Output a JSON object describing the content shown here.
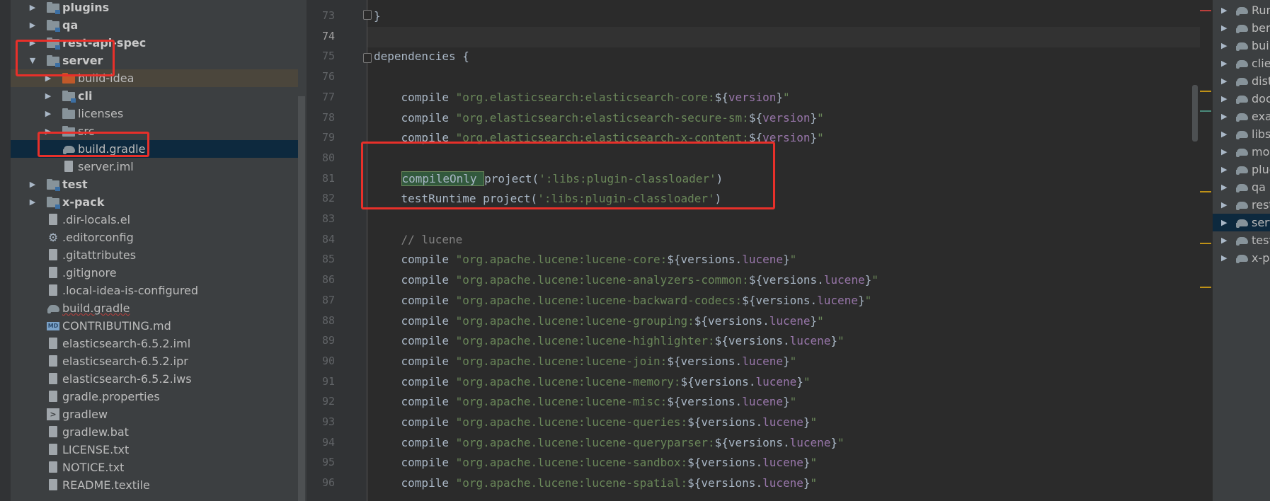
{
  "tree": {
    "items": [
      {
        "label": "plugins",
        "type": "folder-module",
        "expand": "collapsed",
        "level": 0,
        "bold": true
      },
      {
        "label": "qa",
        "type": "folder-module",
        "expand": "collapsed",
        "level": 0,
        "bold": true
      },
      {
        "label": "rest-api-spec",
        "type": "folder-module",
        "expand": "collapsed",
        "level": 0,
        "bold": true
      },
      {
        "label": "server",
        "type": "folder-module",
        "expand": "expanded",
        "level": 0,
        "bold": true
      },
      {
        "label": "build-idea",
        "type": "folder-orange",
        "expand": "collapsed",
        "level": 1,
        "bold": false
      },
      {
        "label": "cli",
        "type": "folder-module",
        "expand": "collapsed",
        "level": 1,
        "bold": true
      },
      {
        "label": "licenses",
        "type": "folder",
        "expand": "collapsed",
        "level": 1,
        "bold": false
      },
      {
        "label": "src",
        "type": "folder",
        "expand": "collapsed",
        "level": 1,
        "bold": false
      },
      {
        "label": "build.gradle",
        "type": "gradle",
        "expand": "none",
        "level": 1,
        "bold": false,
        "selected": true
      },
      {
        "label": "server.iml",
        "type": "file",
        "expand": "none",
        "level": 1,
        "bold": false
      },
      {
        "label": "test",
        "type": "folder-module",
        "expand": "collapsed",
        "level": 0,
        "bold": true
      },
      {
        "label": "x-pack",
        "type": "folder-module",
        "expand": "collapsed",
        "level": 0,
        "bold": true
      },
      {
        "label": ".dir-locals.el",
        "type": "file",
        "expand": "none",
        "level": 0,
        "bold": false
      },
      {
        "label": ".editorconfig",
        "type": "gear",
        "expand": "none",
        "level": 0,
        "bold": false
      },
      {
        "label": ".gitattributes",
        "type": "file",
        "expand": "none",
        "level": 0,
        "bold": false
      },
      {
        "label": ".gitignore",
        "type": "file",
        "expand": "none",
        "level": 0,
        "bold": false
      },
      {
        "label": ".local-idea-is-configured",
        "type": "file",
        "expand": "none",
        "level": 0,
        "bold": false
      },
      {
        "label": "build.gradle",
        "type": "gradle",
        "expand": "none",
        "level": 0,
        "bold": false,
        "squiggle": true
      },
      {
        "label": "CONTRIBUTING.md",
        "type": "md",
        "expand": "none",
        "level": 0,
        "bold": false
      },
      {
        "label": "elasticsearch-6.5.2.iml",
        "type": "file",
        "expand": "none",
        "level": 0,
        "bold": false
      },
      {
        "label": "elasticsearch-6.5.2.ipr",
        "type": "file",
        "expand": "none",
        "level": 0,
        "bold": false
      },
      {
        "label": "elasticsearch-6.5.2.iws",
        "type": "file",
        "expand": "none",
        "level": 0,
        "bold": false
      },
      {
        "label": "gradle.properties",
        "type": "file",
        "expand": "none",
        "level": 0,
        "bold": false
      },
      {
        "label": "gradlew",
        "type": "terminal",
        "expand": "none",
        "level": 0,
        "bold": false
      },
      {
        "label": "gradlew.bat",
        "type": "file",
        "expand": "none",
        "level": 0,
        "bold": false
      },
      {
        "label": "LICENSE.txt",
        "type": "file",
        "expand": "none",
        "level": 0,
        "bold": false
      },
      {
        "label": "NOTICE.txt",
        "type": "file",
        "expand": "none",
        "level": 0,
        "bold": false
      },
      {
        "label": "README.textile",
        "type": "file",
        "expand": "none",
        "level": 0,
        "bold": false
      }
    ]
  },
  "editor": {
    "current_line": "74",
    "lines": [
      {
        "num": "73",
        "tokens": [
          {
            "t": "}",
            "c": "kw"
          }
        ]
      },
      {
        "num": "74",
        "tokens": []
      },
      {
        "num": "75",
        "tokens": [
          {
            "t": "dependencies {",
            "c": "kw"
          }
        ]
      },
      {
        "num": "76",
        "tokens": []
      },
      {
        "num": "77",
        "tokens": [
          {
            "t": "    compile ",
            "c": "kw"
          },
          {
            "t": "\"org.elasticsearch:elasticsearch-core:",
            "c": "str"
          },
          {
            "t": "${",
            "c": "kw"
          },
          {
            "t": "version",
            "c": "var"
          },
          {
            "t": "}",
            "c": "kw"
          },
          {
            "t": "\"",
            "c": "str"
          }
        ]
      },
      {
        "num": "78",
        "tokens": [
          {
            "t": "    compile ",
            "c": "kw"
          },
          {
            "t": "\"org.elasticsearch:elasticsearch-secure-sm:",
            "c": "str"
          },
          {
            "t": "${",
            "c": "kw"
          },
          {
            "t": "version",
            "c": "var"
          },
          {
            "t": "}",
            "c": "kw"
          },
          {
            "t": "\"",
            "c": "str"
          }
        ]
      },
      {
        "num": "79",
        "tokens": [
          {
            "t": "    compile ",
            "c": "kw"
          },
          {
            "t": "\"org.elasticsearch:elasticsearch-x-content:",
            "c": "str"
          },
          {
            "t": "${",
            "c": "kw"
          },
          {
            "t": "version",
            "c": "var"
          },
          {
            "t": "}",
            "c": "kw"
          },
          {
            "t": "\"",
            "c": "str"
          }
        ]
      },
      {
        "num": "80",
        "tokens": []
      },
      {
        "num": "81",
        "tokens": [
          {
            "t": "    ",
            "c": "kw"
          },
          {
            "t": "compileOnly ",
            "c": "mark"
          },
          {
            "t": "project(",
            "c": "kw"
          },
          {
            "t": "':libs:plugin-classloader'",
            "c": "str"
          },
          {
            "t": ")",
            "c": "kw"
          }
        ]
      },
      {
        "num": "82",
        "tokens": [
          {
            "t": "    testRuntime project(",
            "c": "kw"
          },
          {
            "t": "':libs:plugin-classloader'",
            "c": "str"
          },
          {
            "t": ")",
            "c": "kw"
          }
        ]
      },
      {
        "num": "83",
        "tokens": []
      },
      {
        "num": "84",
        "tokens": [
          {
            "t": "    // lucene",
            "c": "cmt"
          }
        ]
      },
      {
        "num": "85",
        "tokens": [
          {
            "t": "    compile ",
            "c": "kw"
          },
          {
            "t": "\"org.apache.lucene:lucene-core:",
            "c": "str"
          },
          {
            "t": "${versions.",
            "c": "kw"
          },
          {
            "t": "lucene",
            "c": "var"
          },
          {
            "t": "}",
            "c": "kw"
          },
          {
            "t": "\"",
            "c": "str"
          }
        ]
      },
      {
        "num": "86",
        "tokens": [
          {
            "t": "    compile ",
            "c": "kw"
          },
          {
            "t": "\"org.apache.lucene:lucene-analyzers-common:",
            "c": "str"
          },
          {
            "t": "${versions.",
            "c": "kw"
          },
          {
            "t": "lucene",
            "c": "var"
          },
          {
            "t": "}",
            "c": "kw"
          },
          {
            "t": "\"",
            "c": "str"
          }
        ]
      },
      {
        "num": "87",
        "tokens": [
          {
            "t": "    compile ",
            "c": "kw"
          },
          {
            "t": "\"org.apache.lucene:lucene-backward-codecs:",
            "c": "str"
          },
          {
            "t": "${versions.",
            "c": "kw"
          },
          {
            "t": "lucene",
            "c": "var"
          },
          {
            "t": "}",
            "c": "kw"
          },
          {
            "t": "\"",
            "c": "str"
          }
        ]
      },
      {
        "num": "88",
        "tokens": [
          {
            "t": "    compile ",
            "c": "kw"
          },
          {
            "t": "\"org.apache.lucene:lucene-grouping:",
            "c": "str"
          },
          {
            "t": "${versions.",
            "c": "kw"
          },
          {
            "t": "lucene",
            "c": "var"
          },
          {
            "t": "}",
            "c": "kw"
          },
          {
            "t": "\"",
            "c": "str"
          }
        ]
      },
      {
        "num": "89",
        "tokens": [
          {
            "t": "    compile ",
            "c": "kw"
          },
          {
            "t": "\"org.apache.lucene:lucene-highlighter:",
            "c": "str"
          },
          {
            "t": "${versions.",
            "c": "kw"
          },
          {
            "t": "lucene",
            "c": "var"
          },
          {
            "t": "}",
            "c": "kw"
          },
          {
            "t": "\"",
            "c": "str"
          }
        ]
      },
      {
        "num": "90",
        "tokens": [
          {
            "t": "    compile ",
            "c": "kw"
          },
          {
            "t": "\"org.apache.lucene:lucene-join:",
            "c": "str"
          },
          {
            "t": "${versions.",
            "c": "kw"
          },
          {
            "t": "lucene",
            "c": "var"
          },
          {
            "t": "}",
            "c": "kw"
          },
          {
            "t": "\"",
            "c": "str"
          }
        ]
      },
      {
        "num": "91",
        "tokens": [
          {
            "t": "    compile ",
            "c": "kw"
          },
          {
            "t": "\"org.apache.lucene:lucene-memory:",
            "c": "str"
          },
          {
            "t": "${versions.",
            "c": "kw"
          },
          {
            "t": "lucene",
            "c": "var"
          },
          {
            "t": "}",
            "c": "kw"
          },
          {
            "t": "\"",
            "c": "str"
          }
        ]
      },
      {
        "num": "92",
        "tokens": [
          {
            "t": "    compile ",
            "c": "kw"
          },
          {
            "t": "\"org.apache.lucene:lucene-misc:",
            "c": "str"
          },
          {
            "t": "${versions.",
            "c": "kw"
          },
          {
            "t": "lucene",
            "c": "var"
          },
          {
            "t": "}",
            "c": "kw"
          },
          {
            "t": "\"",
            "c": "str"
          }
        ]
      },
      {
        "num": "93",
        "tokens": [
          {
            "t": "    compile ",
            "c": "kw"
          },
          {
            "t": "\"org.apache.lucene:lucene-queries:",
            "c": "str"
          },
          {
            "t": "${versions.",
            "c": "kw"
          },
          {
            "t": "lucene",
            "c": "var"
          },
          {
            "t": "}",
            "c": "kw"
          },
          {
            "t": "\"",
            "c": "str"
          }
        ]
      },
      {
        "num": "94",
        "tokens": [
          {
            "t": "    compile ",
            "c": "kw"
          },
          {
            "t": "\"org.apache.lucene:lucene-queryparser:",
            "c": "str"
          },
          {
            "t": "${versions.",
            "c": "kw"
          },
          {
            "t": "lucene",
            "c": "var"
          },
          {
            "t": "}",
            "c": "kw"
          },
          {
            "t": "\"",
            "c": "str"
          }
        ]
      },
      {
        "num": "95",
        "tokens": [
          {
            "t": "    compile ",
            "c": "kw"
          },
          {
            "t": "\"org.apache.lucene:lucene-sandbox:",
            "c": "str"
          },
          {
            "t": "${versions.",
            "c": "kw"
          },
          {
            "t": "lucene",
            "c": "var"
          },
          {
            "t": "}",
            "c": "kw"
          },
          {
            "t": "\"",
            "c": "str"
          }
        ]
      },
      {
        "num": "96",
        "tokens": [
          {
            "t": "    compile ",
            "c": "kw"
          },
          {
            "t": "\"org.apache.lucene:lucene-spatial:",
            "c": "str"
          },
          {
            "t": "${versions.",
            "c": "kw"
          },
          {
            "t": "lucene",
            "c": "var"
          },
          {
            "t": "}",
            "c": "kw"
          },
          {
            "t": "\"",
            "c": "str"
          }
        ]
      }
    ]
  },
  "gradle_panel": {
    "items": [
      {
        "label": "Run Configurations",
        "icon": "gradle-run-icon"
      },
      {
        "label": "benchmarks",
        "icon": "gradle-elephant-icon"
      },
      {
        "label": "buildSrc",
        "icon": "gradle-elephant-icon"
      },
      {
        "label": "client",
        "icon": "gradle-elephant-icon"
      },
      {
        "label": "distribution",
        "icon": "gradle-elephant-icon"
      },
      {
        "label": "docs",
        "icon": "gradle-elephant-icon"
      },
      {
        "label": "example-plugins",
        "icon": "gradle-elephant-icon"
      },
      {
        "label": "libs",
        "icon": "gradle-elephant-icon"
      },
      {
        "label": "modules",
        "icon": "gradle-elephant-icon"
      },
      {
        "label": "plugins",
        "icon": "gradle-elephant-icon"
      },
      {
        "label": "qa",
        "icon": "gradle-elephant-icon"
      },
      {
        "label": "rest-api-spec",
        "icon": "gradle-elephant-icon"
      },
      {
        "label": "server",
        "icon": "gradle-elephant-icon",
        "selected": true
      },
      {
        "label": "test",
        "icon": "gradle-elephant-icon"
      },
      {
        "label": "x-pack",
        "icon": "gradle-elephant-icon"
      }
    ]
  },
  "colors": {
    "annotation": "#e8302a",
    "string": "#6a8759",
    "variable": "#9876aa",
    "selection": "#0d293e"
  }
}
